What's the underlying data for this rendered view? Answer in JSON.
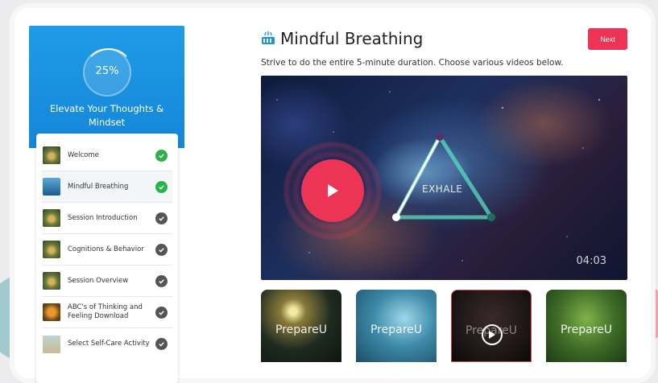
{
  "sidebar": {
    "progress": "25%",
    "progress_value": 0.25,
    "title": "Elevate Your Thoughts & Mindset",
    "lessons": [
      {
        "label": "Welcome",
        "status": "complete",
        "thumb": "butterfly-thumb"
      },
      {
        "label": "Mindful Breathing",
        "status": "complete",
        "thumb": "ocean-thumb"
      },
      {
        "label": "Session Introduction",
        "status": "incomplete",
        "thumb": "butterfly-thumb"
      },
      {
        "label": "Cognitions & Behavior",
        "status": "incomplete",
        "thumb": "butterfly-thumb"
      },
      {
        "label": "Session Overview",
        "status": "incomplete",
        "thumb": "butterfly-thumb"
      },
      {
        "label": "ABC's of Thinking and Feeling Download",
        "status": "incomplete",
        "thumb": "monarch-thumb"
      },
      {
        "label": "Select Self-Care Activity",
        "status": "incomplete",
        "thumb": "beach-thumb"
      }
    ]
  },
  "header": {
    "title": "Mindful Breathing",
    "icon": "breathing-icon",
    "subtitle": "Strive to do the entire 5-minute duration. Choose various videos below.",
    "next_label": "Next"
  },
  "video": {
    "overlay_text": "EXHALE",
    "duration": "04:03"
  },
  "cards": [
    {
      "brand": "PrepareU"
    },
    {
      "brand": "PrepareU"
    },
    {
      "brand": "PrepareU"
    },
    {
      "brand": "PrepareU"
    }
  ],
  "colors": {
    "accent": "#ee3456",
    "sidebar_blue": "#1a92e0",
    "complete_green": "#2bb34b",
    "incomplete_gray": "#555555"
  }
}
